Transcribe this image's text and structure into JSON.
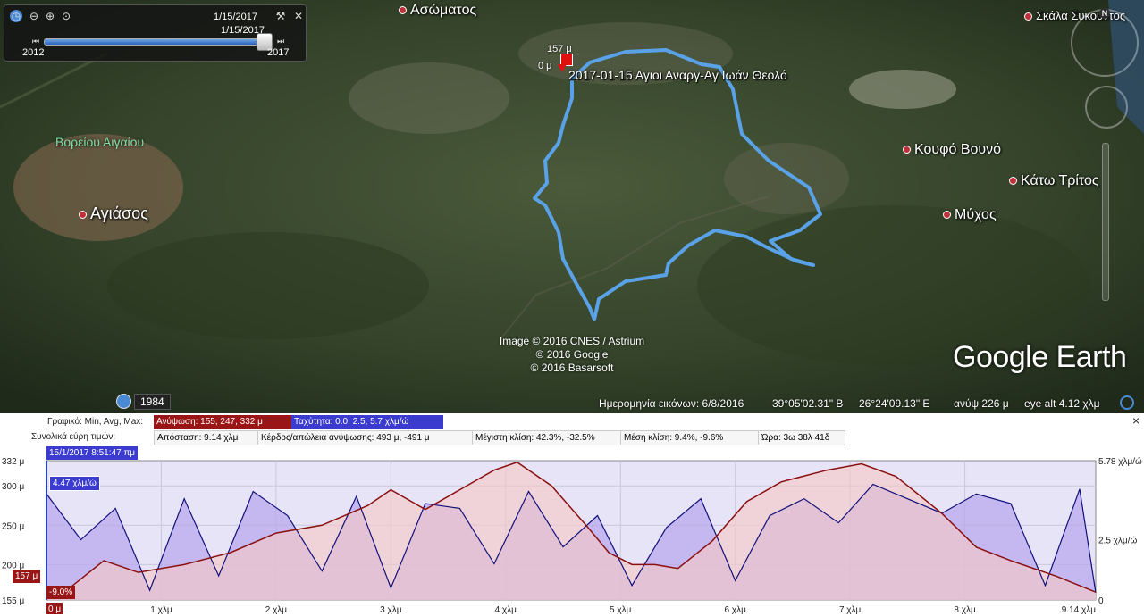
{
  "time_slider": {
    "current_date": "1/15/2017",
    "thumb_date": "1/15/2017",
    "start_year": "2012",
    "end_year": "2017"
  },
  "map": {
    "places": [
      {
        "name": "Ασώματος",
        "dot": true
      },
      {
        "name": "Σκάλα Συκουντος",
        "dot": true
      },
      {
        "name": "Αγιάσος",
        "dot": true
      },
      {
        "name": "Κουφό Βουνό",
        "dot": true
      },
      {
        "name": "Κάτω Τρίτος",
        "dot": true
      },
      {
        "name": "Μύχος",
        "dot": true
      }
    ],
    "region_label": "Βορείου Αιγαίου",
    "track_name": "2017-01-15 Αγιοι Αναργ-Αγ Ιωάν Θεολό",
    "marker_elevation": "157 μ",
    "marker_distance": "0 μ",
    "credits": [
      "Image © 2016 CNES / Astrium",
      "© 2016 Google",
      "© 2016 Basarsoft"
    ],
    "logo": "Google Earth",
    "north_label": "N",
    "historical_year": "1984"
  },
  "status_bar": {
    "imagery_date": "Ημερομηνία εικόνων: 6/8/2016",
    "lat": "39°05'02.31\" Β",
    "lon": "26°24'09.13\" Ε",
    "elev": "ανύψ   226 μ",
    "eye_alt": "eye alt   4.12 χλμ"
  },
  "profile": {
    "row1_label": "Γραφικό: Min, Avg, Max:",
    "elevation_stats": "Ανύψωση: 155, 247, 332 μ",
    "speed_stats": "Ταχύτητα: 0.0, 2.5, 5.7 χλμ/ώ",
    "row2_label": "Συνολικά εύρη τιμών:",
    "distance": "Απόσταση: 9.14 χλμ",
    "gain_loss": "Κέρδος/απώλεια ανύψωσης: 493 μ, -491 μ",
    "max_slope": "Μέγιστη κλίση: 42.3%, -32.5%",
    "avg_slope": "Μέση κλίση: 9.4%, -9.6%",
    "time": "Ώρα: 3ω 38λ 41δ",
    "cursor_time": "15/1/2017 8:51:47 πμ",
    "cursor_speed": "4.47 χλμ/ώ",
    "cursor_elev": "157 μ",
    "cursor_slope": "-9.0%",
    "close": "×",
    "colors": {
      "elevation": "#8a1010",
      "speed": "#10107a",
      "elev_fill": "#f4c8c8",
      "speed_fill": "#b9a8ec"
    }
  },
  "chart_data": {
    "type": "line",
    "x_label_unit": "χλμ",
    "x_ticks": [
      "0 μ",
      "1 χλμ",
      "2 χλμ",
      "3 χλμ",
      "4 χλμ",
      "5 χλμ",
      "6 χλμ",
      "7 χλμ",
      "8 χλμ",
      "9.14 χλμ"
    ],
    "xlim": [
      0,
      9.14
    ],
    "y_left_ticks": [
      "332 μ",
      "300 μ",
      "250 μ",
      "200 μ",
      "155 μ"
    ],
    "ylim_left": [
      155,
      332
    ],
    "y_right_ticks": [
      "5.78 χλμ/ώ",
      "2.5 χλμ/ώ",
      "0"
    ],
    "ylim_right": [
      0,
      5.78
    ],
    "series": [
      {
        "name": "Ανύψωση",
        "x": [
          0,
          0.2,
          0.5,
          0.8,
          1.2,
          1.6,
          2.0,
          2.4,
          2.8,
          3.0,
          3.3,
          3.6,
          3.9,
          4.1,
          4.4,
          4.7,
          4.9,
          5.1,
          5.3,
          5.5,
          5.8,
          6.1,
          6.4,
          6.8,
          7.1,
          7.4,
          7.8,
          8.1,
          8.4,
          8.8,
          9.14
        ],
        "values": [
          157,
          170,
          205,
          190,
          200,
          215,
          240,
          250,
          275,
          295,
          270,
          295,
          320,
          330,
          300,
          250,
          215,
          200,
          200,
          195,
          230,
          280,
          305,
          320,
          328,
          312,
          265,
          222,
          205,
          185,
          165
        ]
      },
      {
        "name": "Ταχύτητα",
        "x": [
          0,
          0.3,
          0.6,
          0.9,
          1.2,
          1.5,
          1.8,
          2.1,
          2.4,
          2.7,
          3.0,
          3.3,
          3.6,
          3.9,
          4.2,
          4.5,
          4.8,
          5.1,
          5.4,
          5.7,
          6.0,
          6.3,
          6.6,
          6.9,
          7.2,
          7.5,
          7.8,
          8.1,
          8.4,
          8.7,
          9.0,
          9.14
        ],
        "values": [
          4.4,
          2.5,
          3.8,
          0.4,
          4.2,
          1.0,
          4.5,
          3.5,
          1.2,
          4.3,
          0.5,
          4.0,
          3.8,
          1.5,
          4.5,
          2.2,
          3.5,
          0.6,
          3.0,
          4.2,
          0.8,
          3.5,
          4.2,
          3.2,
          4.8,
          4.2,
          3.6,
          4.4,
          4.0,
          0.6,
          4.6,
          0.3
        ]
      }
    ]
  }
}
